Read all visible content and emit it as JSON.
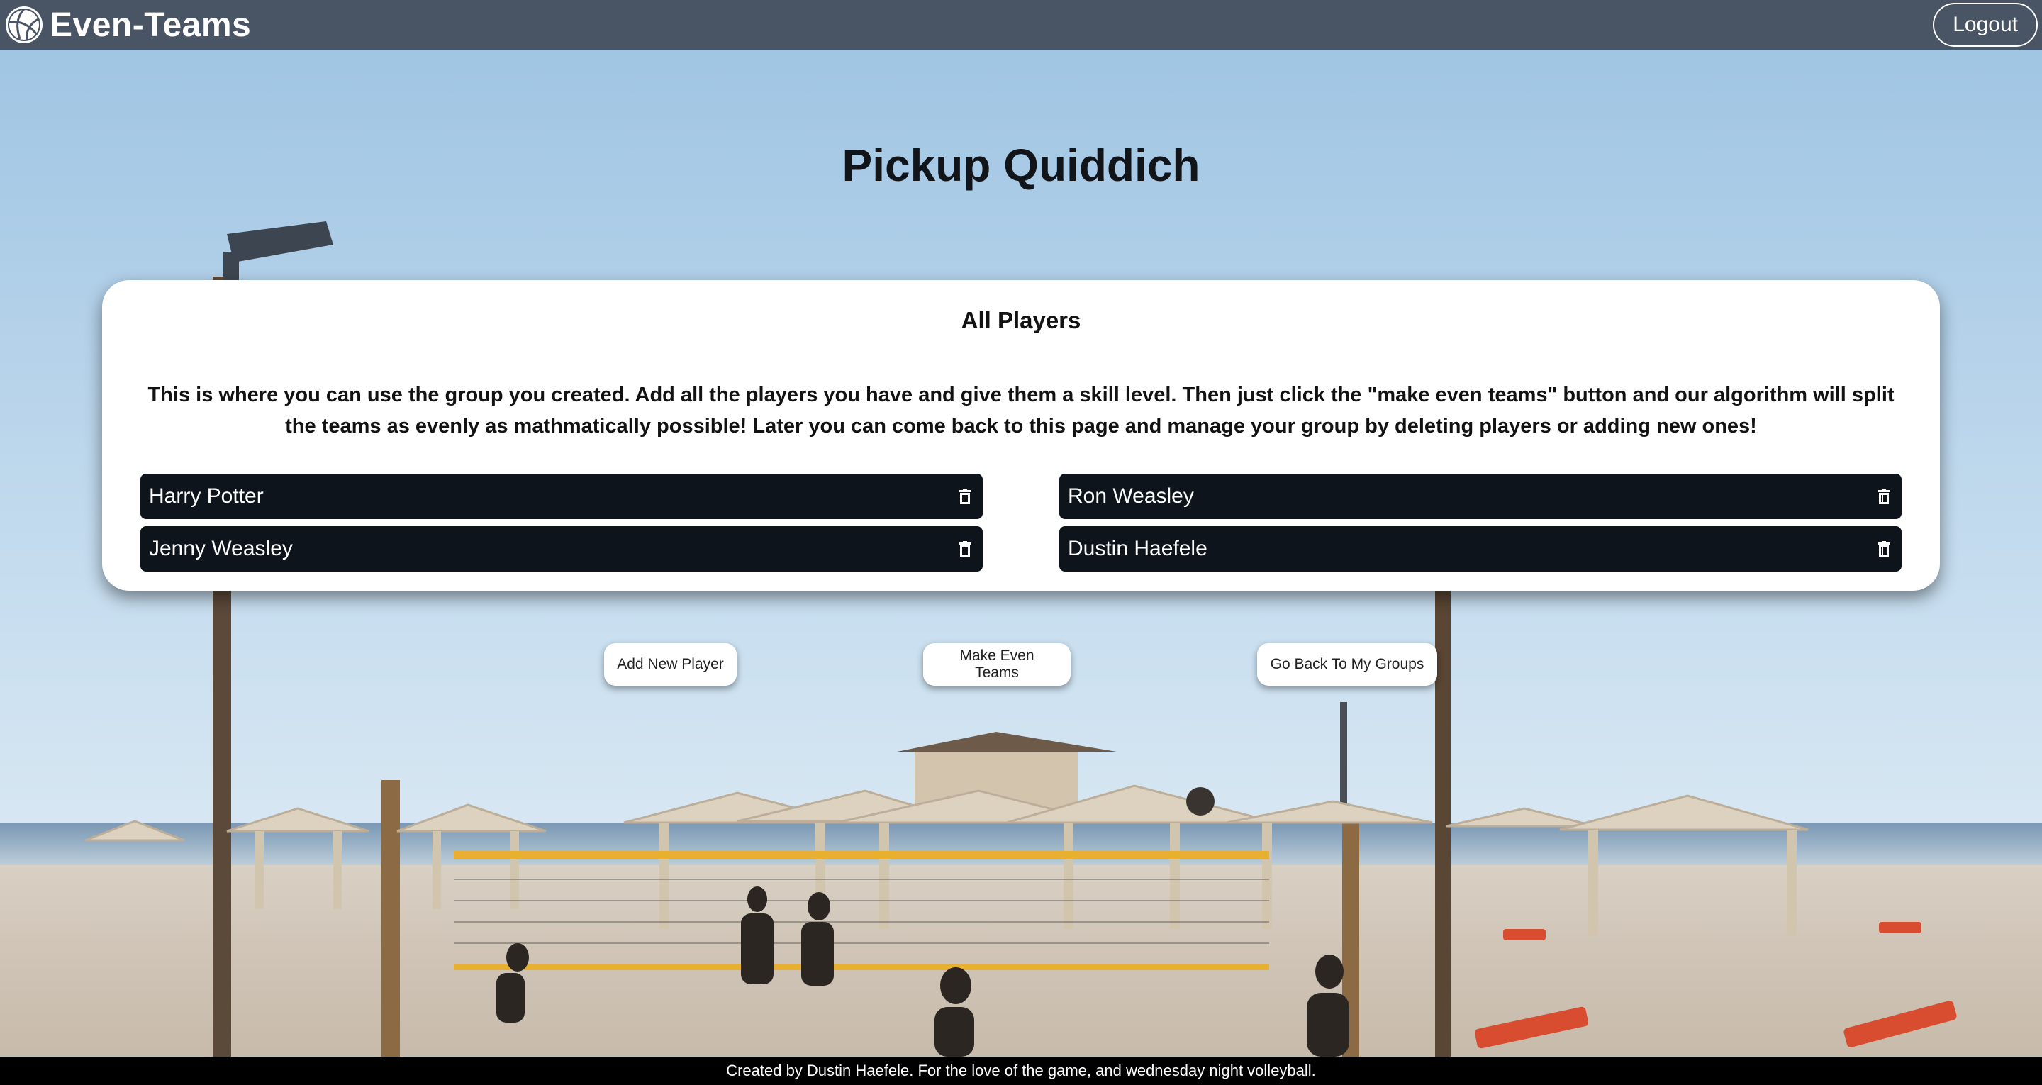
{
  "header": {
    "brand": "Even-Teams",
    "logout_label": "Logout"
  },
  "page_title": "Pickup Quiddich",
  "card": {
    "title": "All Players",
    "description": "This is where you can use the group you created. Add all the players you have and give them a skill level. Then just click the \"make even teams\" button and our algorithm will split the teams as evenly as mathmatically possible! Later you can come back to this page and manage your group by deleting players or adding new ones!",
    "players": [
      {
        "name": "Harry Potter"
      },
      {
        "name": "Ron Weasley"
      },
      {
        "name": "Jenny Weasley"
      },
      {
        "name": "Dustin Haefele"
      }
    ]
  },
  "actions": {
    "add_player": "Add New Player",
    "make_teams": "Make Even Teams",
    "go_back": "Go Back To My Groups"
  },
  "footer": {
    "text": "Created by Dustin Haefele. For the love of the game, and wednesday night volleyball."
  },
  "colors": {
    "header_bg": "#495565",
    "player_bg": "#0d141c",
    "card_bg": "#ffffff",
    "footer_bg": "#000000"
  }
}
